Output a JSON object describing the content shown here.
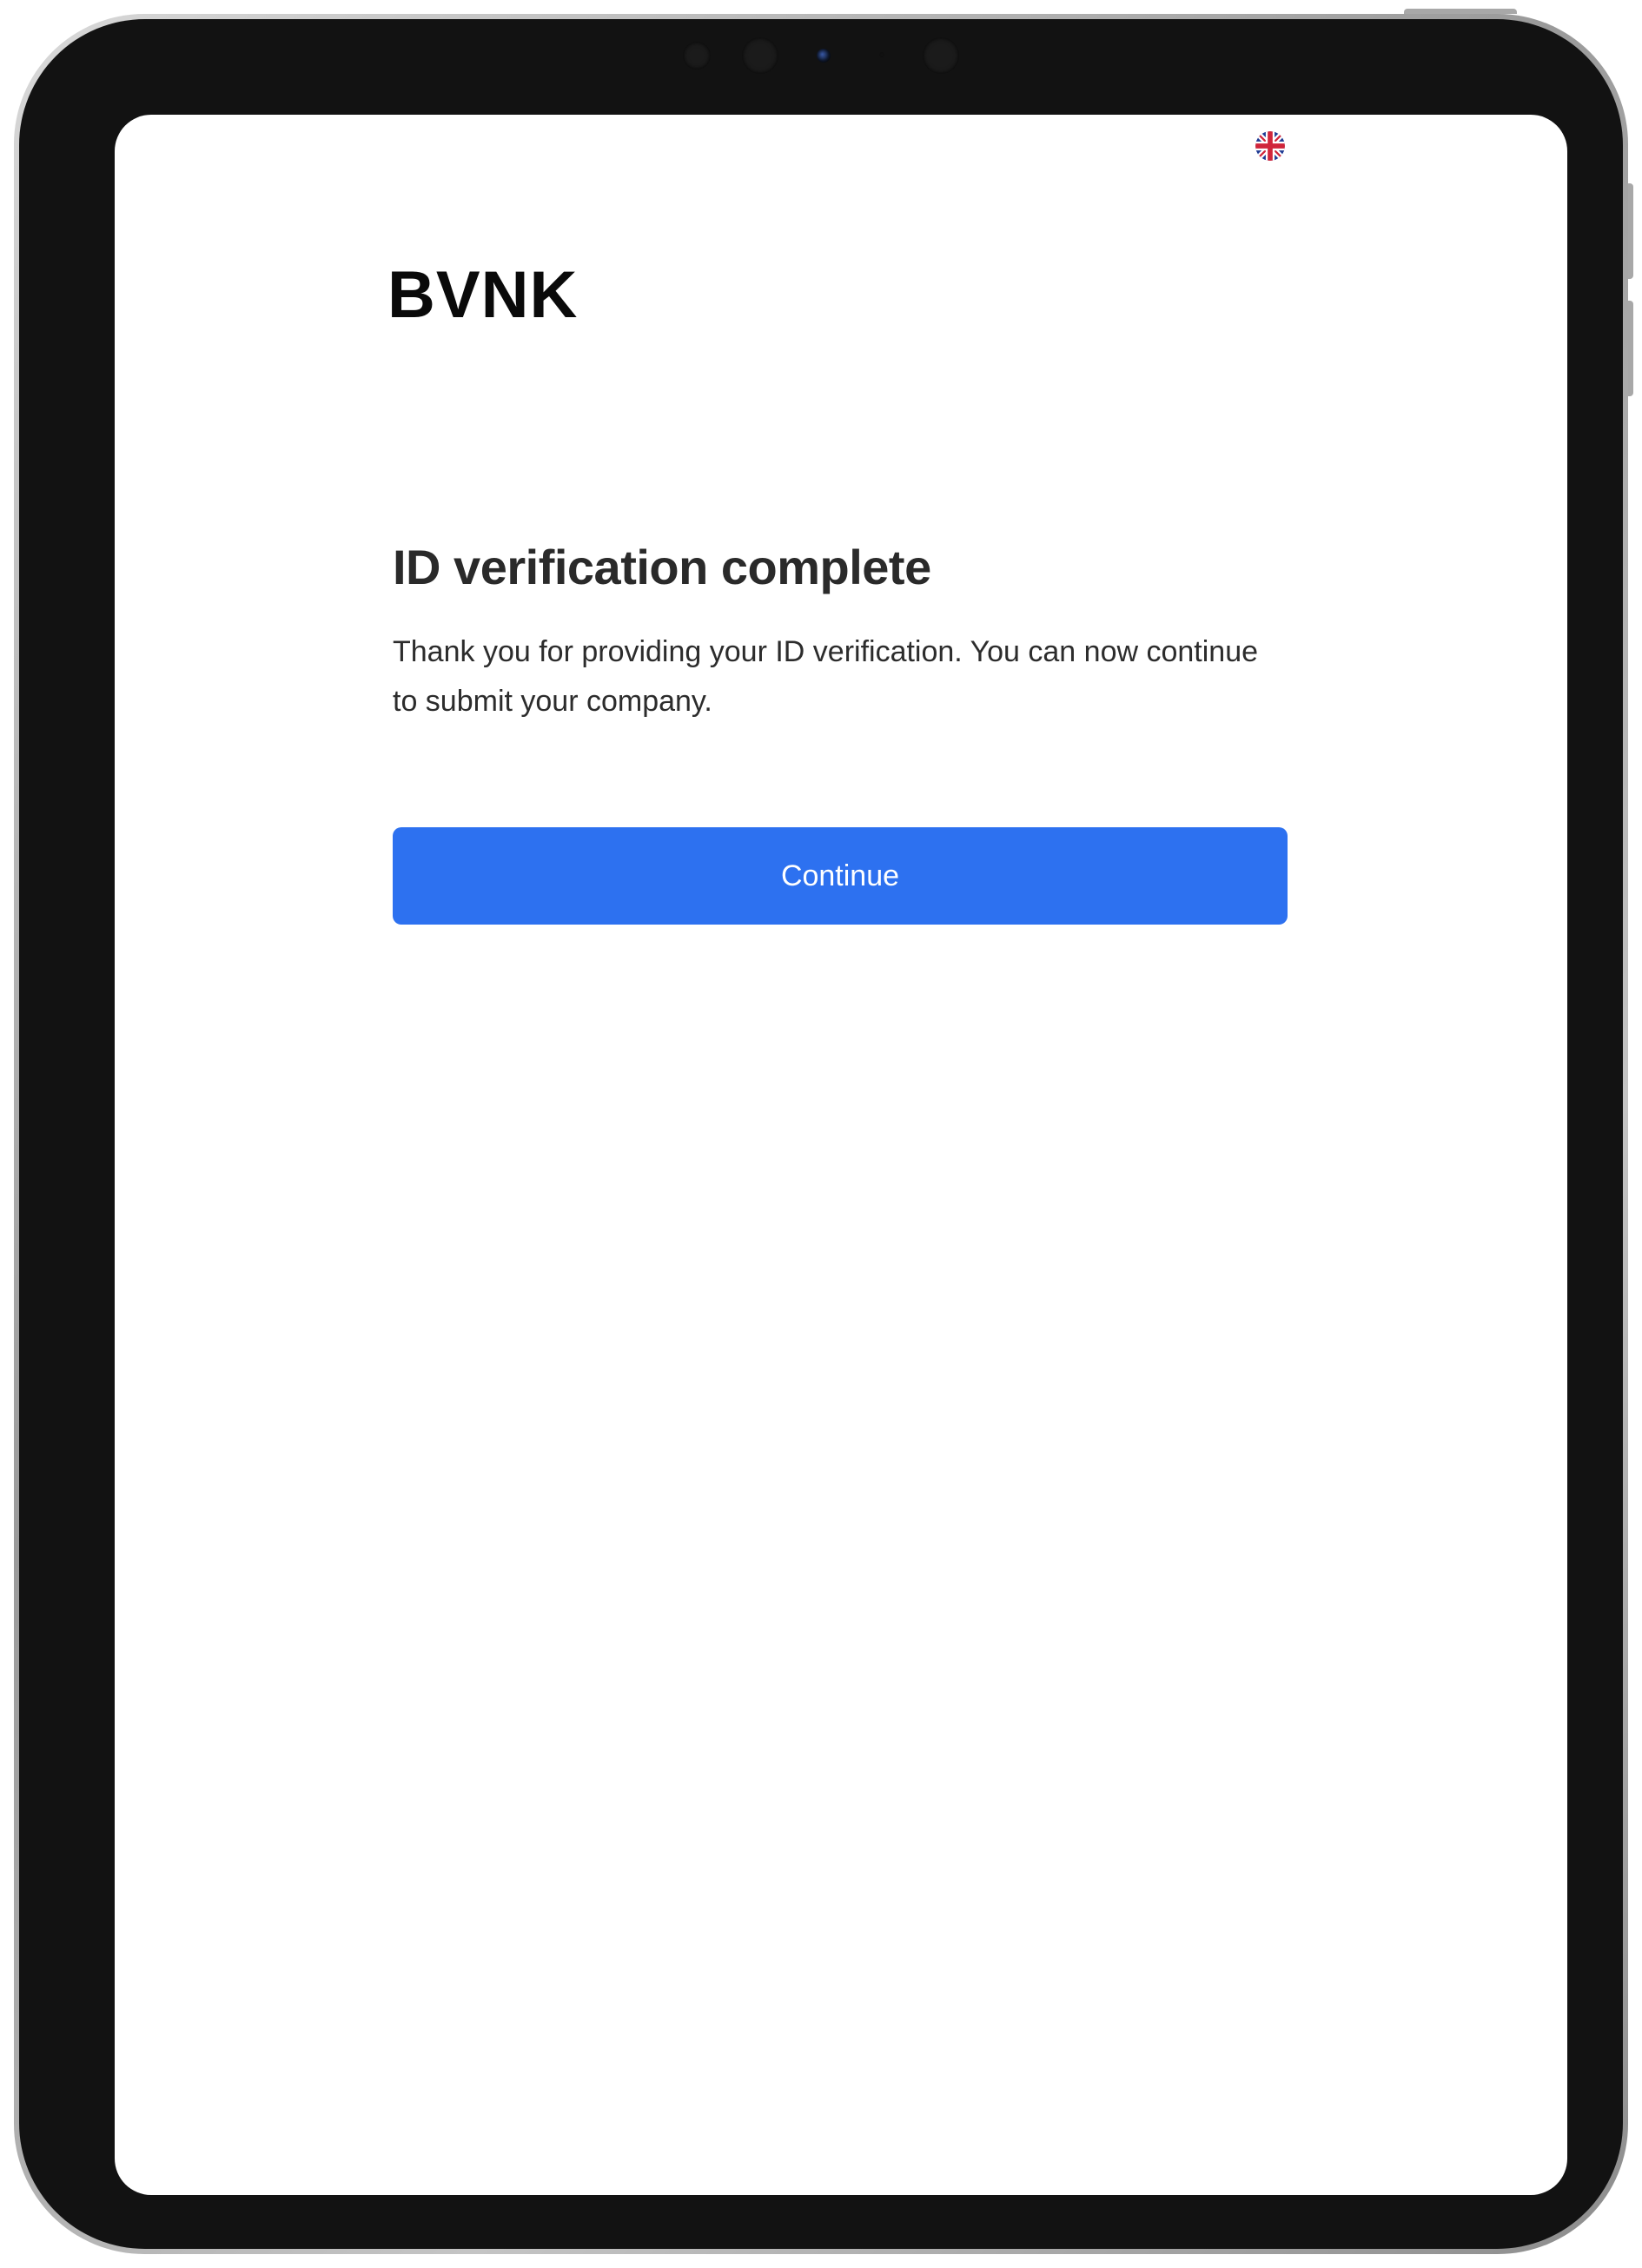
{
  "app": {
    "brand": "BVNK",
    "language_icon": "uk-flag-icon"
  },
  "page": {
    "title": "ID verification complete",
    "description": "Thank you for providing your ID verification. You can now continue to submit your company."
  },
  "actions": {
    "continue_label": "Continue"
  },
  "colors": {
    "accent": "#2d71f0",
    "title_text": "#2a2a2a",
    "body_text": "#2c2c2c",
    "device_frame": "#121212"
  }
}
